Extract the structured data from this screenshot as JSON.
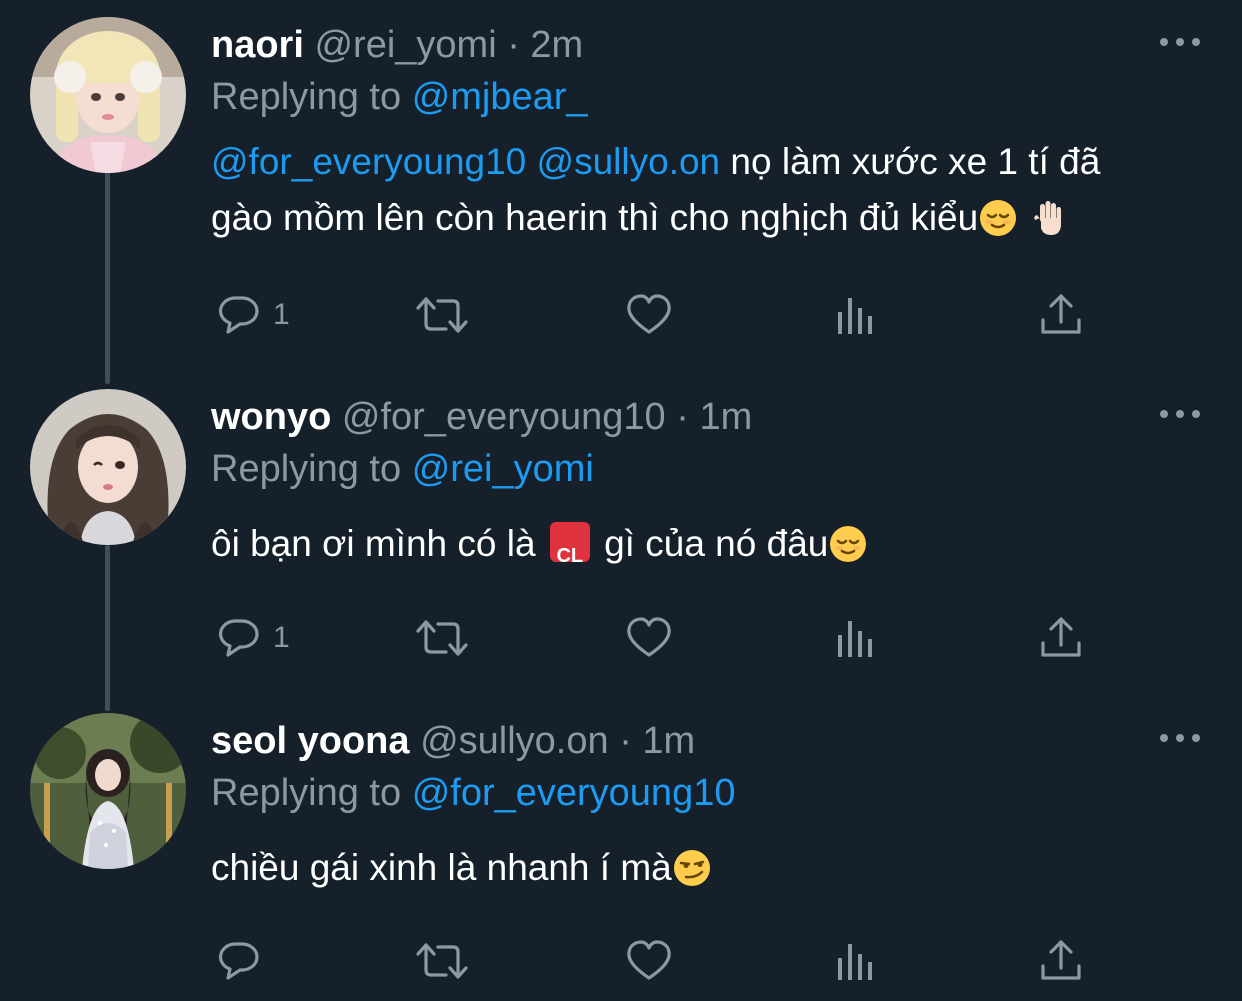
{
  "tweets": [
    {
      "name": "naori",
      "handle": "@rei_yomi",
      "separator": "·",
      "time": "2m",
      "replying_label": "Replying to",
      "replying_to": "@mjbear_",
      "mentions": [
        "@for_everyoung10",
        "@sullyo.on"
      ],
      "text_line1": "nọ làm xước xe 1 tí đã",
      "text_line2": "gào mồm lên còn haerin thì cho nghịch đủ kiểu",
      "emojis": [
        "relieved-face",
        "raised-hand"
      ],
      "reply_count": "1"
    },
    {
      "name": "wonyo",
      "handle": "@for_everyoung10",
      "separator": "·",
      "time": "1m",
      "replying_label": "Replying to",
      "replying_to": "@rei_yomi",
      "text_part1": "ôi bạn ơi mình có là",
      "badge": "CL",
      "text_part2": "gì của nó đâu",
      "emojis": [
        "cl-button",
        "relieved-face"
      ],
      "reply_count": "1"
    },
    {
      "name": "seol yoona",
      "handle": "@sullyo.on",
      "separator": "·",
      "time": "1m",
      "replying_label": "Replying to",
      "replying_to": "@for_everyoung10",
      "text": "chiều gái xinh là nhanh í mà",
      "emojis": [
        "smirking-face"
      ],
      "reply_count": ""
    }
  ],
  "colors": {
    "background": "#15202b",
    "text": "#ffffff",
    "secondary": "#8b98a5",
    "accent": "#1d9bf0",
    "thread_line": "#3d4f5f"
  },
  "icons": [
    "reply-icon",
    "retweet-icon",
    "like-icon",
    "analytics-icon",
    "share-icon",
    "more-icon"
  ]
}
